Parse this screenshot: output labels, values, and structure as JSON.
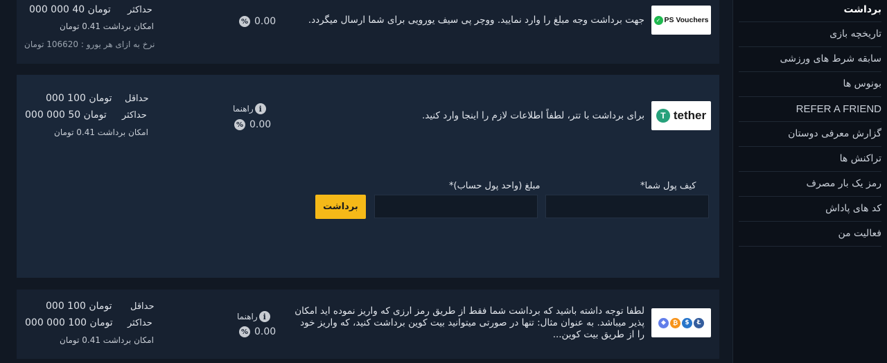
{
  "sidebar": {
    "items": [
      {
        "label": "برداشت",
        "active": true
      },
      {
        "label": "تاریخچه بازی"
      },
      {
        "label": "سابقه شرط های ورزشی"
      },
      {
        "label": "بونوس ها"
      },
      {
        "label": "REFER A FRIEND"
      },
      {
        "label": "گزارش معرفی دوستان"
      },
      {
        "label": "تراکنش ها"
      },
      {
        "label": "رمز یک بار مصرف"
      },
      {
        "label": "کد های پاداش"
      },
      {
        "label": "فعالیت من"
      }
    ]
  },
  "methods": {
    "pvouchers": {
      "logo_text": "PS Vouchers",
      "description": "جهت برداشت وجه مبلغ را وارد نمایید. ووچر پی سیف یورویی برای شما ارسال میگردد.",
      "fee": "0.00",
      "max_label": "حداکثر",
      "max_value": "000 000 40 تومان",
      "possibility": "امکان برداشت 0.41 تومان",
      "rate": "نرخ به ازای هر یورو : 106620 تومان"
    },
    "tether": {
      "logo_text": "tether",
      "description": "برای برداشت با تتر، لطفاً اطلاعات لازم را اینجا وارد کنید.",
      "guide": "راهنما",
      "fee": "0.00",
      "min_label": "حداقل",
      "min_value": "000 100 تومان",
      "max_label": "حداکثر",
      "max_value": "000 000 50 تومان",
      "possibility": "امکان برداشت 0.41 تومان",
      "wallet_label": "کیف پول شما*",
      "wallet_value": "",
      "amount_label": "مبلغ (واحد پول حساب)*",
      "amount_value": "",
      "submit_label": "برداشت"
    },
    "crypto": {
      "description": "لطفا توجه داشته باشید که برداشت شما فقط از طریق رمز ارزی که واریز نموده اید امکان پذیر میباشد. به عنوان مثال: تنها در صورتی میتوانید بیت کوین برداشت کنید، که واریز خود را از طریق بیت کوین...",
      "guide": "راهنما",
      "fee": "0.00",
      "min_label": "حداقل",
      "min_value": "000 100 تومان",
      "max_label": "حداکثر",
      "max_value": "000 000 100 تومان",
      "possibility": "امکان برداشت 0.41 تومان"
    }
  },
  "colors": {
    "accent": "#f5b918",
    "tether_green": "#26a17b",
    "card_bg": "#172130",
    "card_active_bg": "#1a2739"
  }
}
